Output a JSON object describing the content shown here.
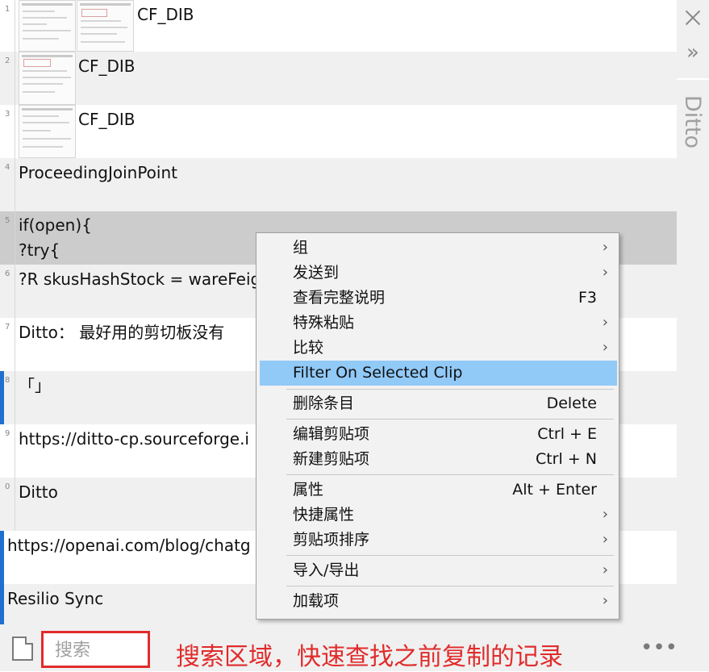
{
  "app": {
    "title": "Ditto"
  },
  "clips": [
    {
      "num": "1",
      "text": "CF_DIB",
      "type": "image"
    },
    {
      "num": "2",
      "text": "CF_DIB",
      "type": "image"
    },
    {
      "num": "3",
      "text": "CF_DIB",
      "type": "image"
    },
    {
      "num": "4",
      "text": "ProceedingJoinPoint"
    },
    {
      "num": "5",
      "text": "if(open){\n?try{"
    },
    {
      "num": "6",
      "text": "?R skusHashStock = wareFeig"
    },
    {
      "num": "7",
      "text": "Ditto： 最好用的剪切板没有"
    },
    {
      "num": "8",
      "text": "「」"
    },
    {
      "num": "9",
      "text": "https://ditto-cp.sourceforge.i"
    },
    {
      "num": "0",
      "text": "Ditto"
    },
    {
      "num": "",
      "text": "https://openai.com/blog/chatg"
    },
    {
      "num": "",
      "text": "Resilio Sync"
    }
  ],
  "context_menu": {
    "items": [
      {
        "label": "组",
        "submenu": true
      },
      {
        "label": "发送到",
        "submenu": true
      },
      {
        "label": "查看完整说明",
        "shortcut": "F3"
      },
      {
        "label": "特殊粘贴",
        "submenu": true
      },
      {
        "label": "比较",
        "submenu": true
      },
      {
        "label": "Filter On Selected Clip",
        "highlighted": true
      },
      {
        "label": "删除条目",
        "shortcut": "Delete"
      },
      {
        "label": "编辑剪贴项",
        "shortcut": "Ctrl + E"
      },
      {
        "label": "新建剪贴项",
        "shortcut": "Ctrl + N"
      },
      {
        "label": "属性",
        "shortcut": "Alt + Enter"
      },
      {
        "label": "快捷属性",
        "submenu": true
      },
      {
        "label": "剪贴项排序",
        "submenu": true
      },
      {
        "label": "导入/导出",
        "submenu": true
      },
      {
        "label": "加载项",
        "submenu": true
      }
    ]
  },
  "search": {
    "placeholder": "搜索"
  },
  "annotation": "搜索区域，快速查找之前复制的记录",
  "icons": {
    "close": "close-icon",
    "expand": "double-chevron-right-icon",
    "new_clip": "document-icon",
    "more": "more-dots-icon",
    "submenu": "chevron-right-icon"
  },
  "colors": {
    "selection": "#cccccc",
    "menu_highlight": "#91c9f7",
    "annotation_red": "#e12b2b",
    "indicator_blue": "#1f6fcf"
  }
}
